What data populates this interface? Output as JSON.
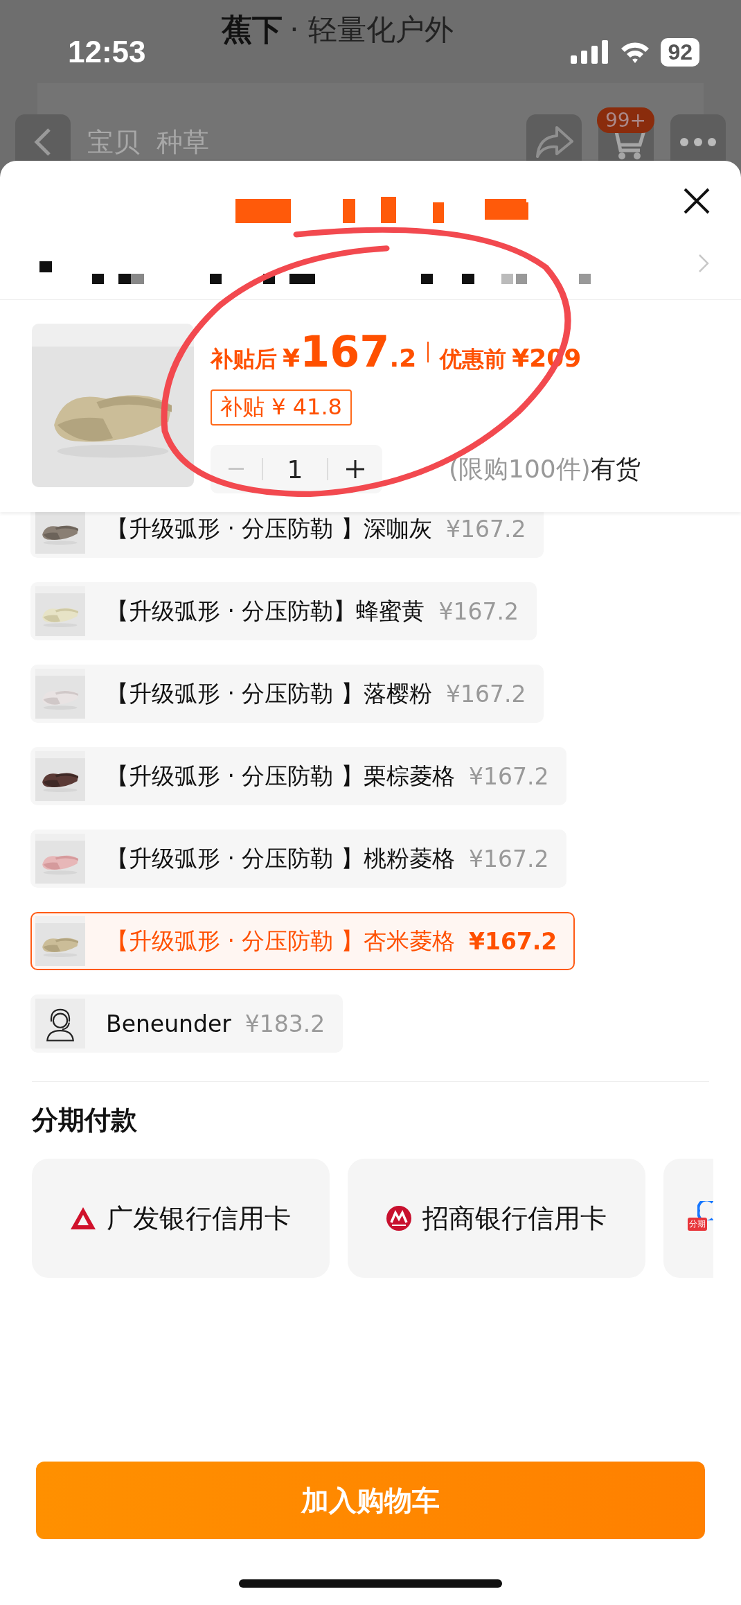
{
  "status_bar": {
    "time": "12:53",
    "battery": "92"
  },
  "page_behind": {
    "brand": "蕉下",
    "brand_suffix": "· 轻量化户外",
    "tabs": [
      {
        "label": "宝贝"
      },
      {
        "label": "种草"
      }
    ],
    "cart_badge": "99+"
  },
  "product": {
    "price_label": "补贴后",
    "price": "¥167.2",
    "original_label": "优惠前",
    "original_price": "¥209",
    "subsidy": "补贴 ¥ 41.8",
    "quantity": "1",
    "minus_disabled": true,
    "limit": "(限购100件)",
    "stock": "有货"
  },
  "variants": [
    {
      "kind": "hat",
      "name": "【升级弧形 · 分压防勒 】深咖灰",
      "price": "¥167.2",
      "selected": false
    },
    {
      "kind": "hat",
      "name": "【升级弧形 · 分压防勒】蜂蜜黄",
      "price": "¥167.2",
      "selected": false
    },
    {
      "kind": "hat",
      "name": "【升级弧形 · 分压防勒 】落樱粉",
      "price": "¥167.2",
      "selected": false
    },
    {
      "kind": "hat",
      "name": "【升级弧形 · 分压防勒 】栗棕菱格",
      "price": "¥167.2",
      "selected": false
    },
    {
      "kind": "hat",
      "name": "【升级弧形 · 分压防勒 】桃粉菱格",
      "price": "¥167.2",
      "selected": false
    },
    {
      "kind": "hat",
      "name": "【升级弧形 · 分压防勒 】杏米菱格",
      "price": "¥167.2",
      "selected": true
    },
    {
      "kind": "service",
      "name": "Beneunder",
      "price": "¥183.2",
      "selected": false
    }
  ],
  "installments": {
    "title": "分期付款",
    "options": [
      {
        "kind": "cgb",
        "name": "广发银行信用卡"
      },
      {
        "kind": "cmb",
        "name": "招商银行信用卡"
      },
      {
        "kind": "huabei",
        "badge": "分期"
      }
    ]
  },
  "add_to_cart": "加入购物车"
}
